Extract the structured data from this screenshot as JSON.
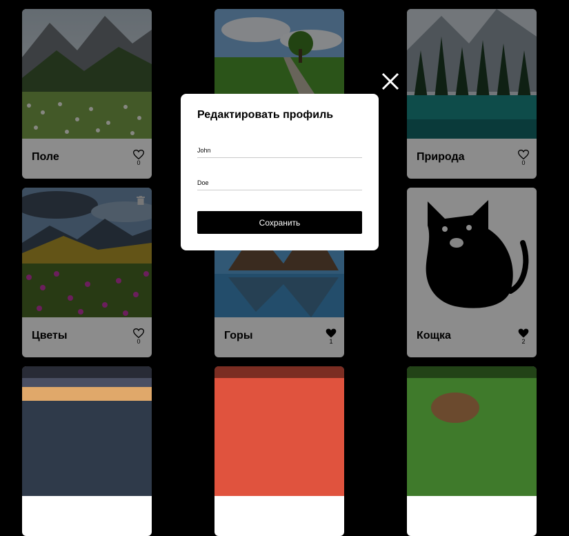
{
  "cards": [
    {
      "title": "",
      "likes": "",
      "liked": false
    },
    {
      "title": "",
      "likes": "",
      "liked": false
    },
    {
      "title": "",
      "likes": "",
      "liked": false
    },
    {
      "title": "Поле",
      "likes": "0",
      "liked": false
    },
    {
      "title": "",
      "likes": "",
      "liked": false
    },
    {
      "title": "Природа",
      "likes": "0",
      "liked": false
    },
    {
      "title": "Цветы",
      "likes": "0",
      "liked": false
    },
    {
      "title": "Горы",
      "likes": "1",
      "liked": true
    },
    {
      "title": "Кощка",
      "likes": "2",
      "liked": true
    }
  ],
  "modal": {
    "title": "Редактировать профиль",
    "first_name_value": "John",
    "last_name_value": "Doe",
    "save_label": "Сохранить"
  },
  "colors": {
    "accent": "#000000",
    "card_bg": "#ffffff",
    "overlay": "#000000"
  }
}
